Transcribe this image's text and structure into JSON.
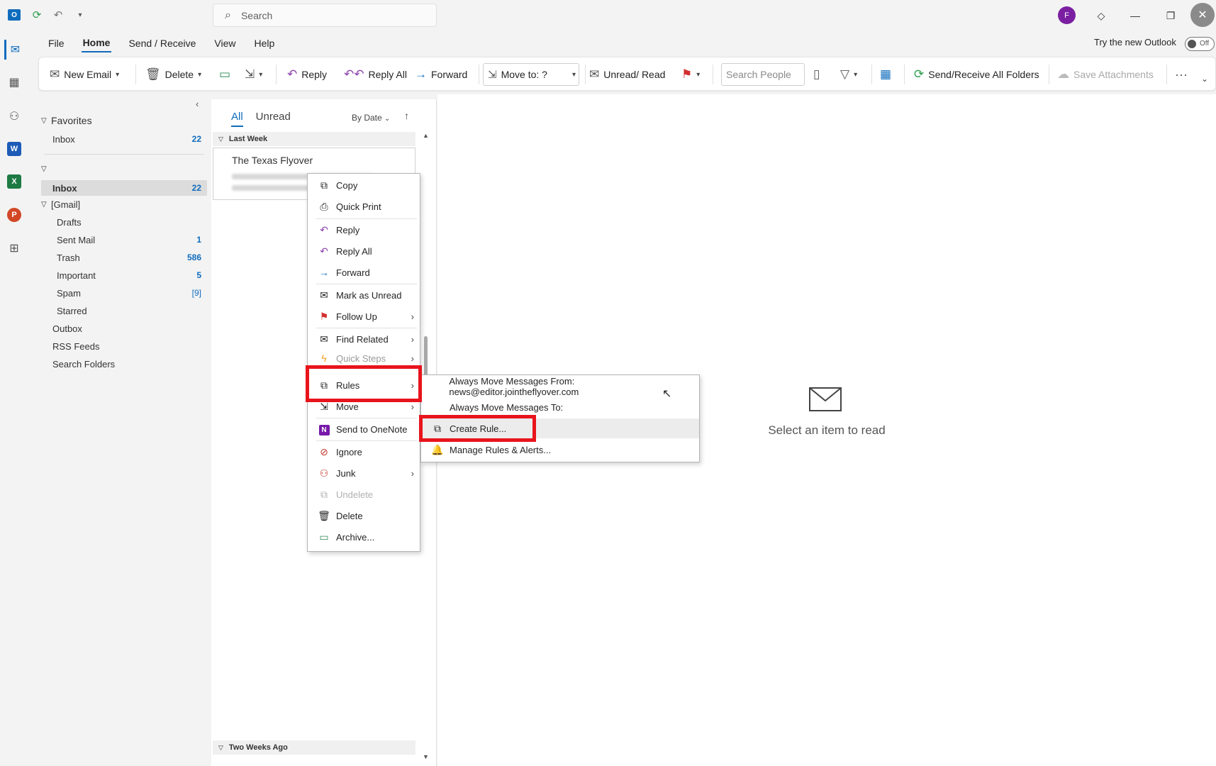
{
  "titlebar": {
    "search_placeholder": "Search",
    "avatar_initial": "F"
  },
  "menubar": {
    "tabs": [
      "File",
      "Home",
      "Send / Receive",
      "View",
      "Help"
    ],
    "active": "Home",
    "try_new_outlook": "Try the new Outlook",
    "toggle_state": "Off"
  },
  "ribbon": {
    "new_email": "New Email",
    "delete": "Delete",
    "reply": "Reply",
    "reply_all": "Reply All",
    "forward": "Forward",
    "move_to": "Move to: ?",
    "unread_read": "Unread/ Read",
    "search_people_placeholder": "Search People",
    "send_receive_all": "Send/Receive All Folders",
    "save_attachments": "Save Attachments"
  },
  "folders": {
    "favorites_label": "Favorites",
    "favorites_inbox": {
      "label": "Inbox",
      "count": "22"
    },
    "account_inbox": {
      "label": "Inbox",
      "count": "22"
    },
    "gmail_label": "[Gmail]",
    "gmail_items": [
      {
        "label": "Drafts",
        "count": ""
      },
      {
        "label": "Sent Mail",
        "count": "1"
      },
      {
        "label": "Trash",
        "count": "586"
      },
      {
        "label": "Important",
        "count": "5"
      },
      {
        "label": "Spam",
        "count": "[9]"
      },
      {
        "label": "Starred",
        "count": ""
      }
    ],
    "other_items": [
      "Outbox",
      "RSS Feeds",
      "Search Folders"
    ]
  },
  "message_list": {
    "tab_all": "All",
    "tab_unread": "Unread",
    "sort": "By Date",
    "group_last_week": "Last Week",
    "group_two_weeks": "Two Weeks Ago",
    "first_message_from": "The Texas Flyover"
  },
  "reading_pane": {
    "empty_text": "Select an item to read"
  },
  "context_menu": {
    "items": [
      {
        "label": "Copy",
        "icon": "copy-icon"
      },
      {
        "label": "Quick Print",
        "icon": "print-icon"
      },
      {
        "label": "Reply",
        "icon": "reply-icon"
      },
      {
        "label": "Reply All",
        "icon": "reply-all-icon"
      },
      {
        "label": "Forward",
        "icon": "forward-icon"
      },
      {
        "label": "Mark as Unread",
        "icon": "envelope-icon"
      },
      {
        "label": "Follow Up",
        "icon": "flag-icon"
      },
      {
        "label": "Find Related",
        "icon": "find-related-icon"
      },
      {
        "label": "Quick Steps",
        "icon": "lightning-icon"
      },
      {
        "label": "Rules",
        "icon": "rules-icon"
      },
      {
        "label": "Move",
        "icon": "move-icon"
      },
      {
        "label": "Send to OneNote",
        "icon": "onenote-icon"
      },
      {
        "label": "Ignore",
        "icon": "ignore-icon"
      },
      {
        "label": "Junk",
        "icon": "junk-icon"
      },
      {
        "label": "Undelete",
        "icon": "undelete-icon"
      },
      {
        "label": "Delete",
        "icon": "trash-icon"
      },
      {
        "label": "Archive...",
        "icon": "archive-icon"
      }
    ]
  },
  "rules_submenu": {
    "always_move_from": "Always Move Messages From: news@editor.jointheflyover.com",
    "always_move_to": "Always Move Messages To:",
    "create_rule": "Create Rule...",
    "manage_rules": "Manage Rules & Alerts..."
  },
  "colors": {
    "accent": "#0f6cbd",
    "highlight": "#e8141c"
  }
}
